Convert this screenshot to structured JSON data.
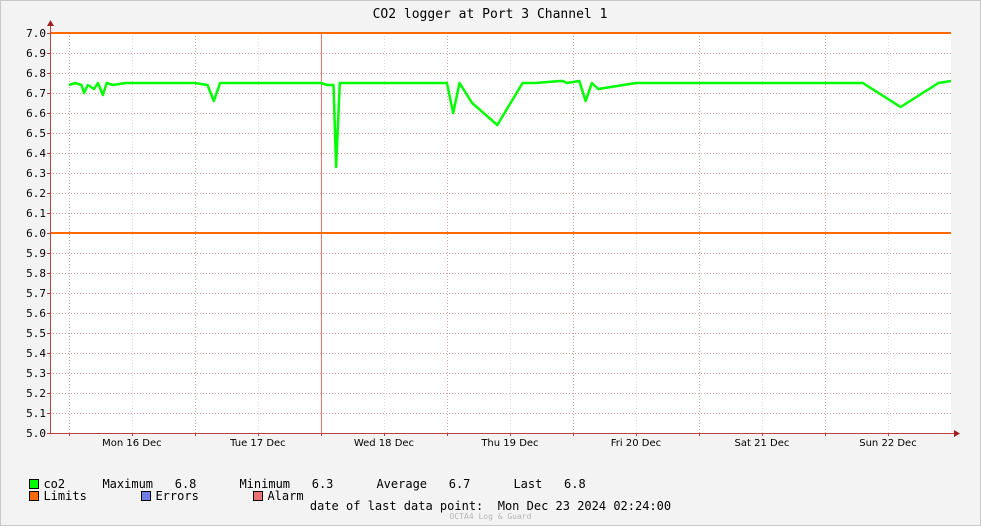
{
  "chart_data": {
    "type": "line",
    "title": "CO2 logger at Port 3 Channel 1",
    "xlabel": "",
    "ylabel": "",
    "ylim": [
      5.0,
      7.0
    ],
    "yticks": [
      "7.0",
      "6.9",
      "6.8",
      "6.7",
      "6.6",
      "6.5",
      "6.4",
      "6.3",
      "6.2",
      "6.1",
      "6.0",
      "5.9",
      "5.8",
      "5.7",
      "5.6",
      "5.5",
      "5.4",
      "5.3",
      "5.2",
      "5.1",
      "5.0"
    ],
    "xticks": [
      "Mon 16 Dec",
      "Tue 17 Dec",
      "Wed 18 Dec",
      "Thu 19 Dec",
      "Fri 20 Dec",
      "Sat 21 Dec",
      "Sun 22 Dec"
    ],
    "grid": true,
    "limits": {
      "upper": 7.0,
      "lower": 6.0
    },
    "series": [
      {
        "name": "co2",
        "color": "#00ff00",
        "x_days": [
          0.0,
          0.05,
          0.1,
          0.12,
          0.15,
          0.2,
          0.23,
          0.27,
          0.3,
          0.35,
          0.45,
          0.5,
          0.7,
          0.9,
          1.0,
          1.1,
          1.15,
          1.2,
          1.4,
          1.7,
          2.0,
          2.05,
          2.1,
          2.12,
          2.15,
          2.3,
          2.6,
          2.8,
          3.0,
          3.05,
          3.1,
          3.2,
          3.4,
          3.6,
          3.7,
          3.9,
          3.92,
          3.95,
          4.05,
          4.1,
          4.15,
          4.2,
          4.5,
          4.9,
          5.1,
          5.3,
          5.5,
          5.8,
          6.1,
          6.2,
          6.3,
          6.6,
          6.9,
          7.0
        ],
        "values": [
          6.74,
          6.75,
          6.74,
          6.7,
          6.74,
          6.72,
          6.75,
          6.69,
          6.75,
          6.74,
          6.75,
          6.75,
          6.75,
          6.75,
          6.75,
          6.74,
          6.66,
          6.75,
          6.75,
          6.75,
          6.75,
          6.74,
          6.74,
          6.33,
          6.75,
          6.75,
          6.75,
          6.75,
          6.75,
          6.6,
          6.75,
          6.65,
          6.54,
          6.75,
          6.75,
          6.76,
          6.76,
          6.75,
          6.76,
          6.66,
          6.75,
          6.72,
          6.75,
          6.75,
          6.75,
          6.75,
          6.75,
          6.75,
          6.75,
          6.75,
          6.75,
          6.63,
          6.75,
          6.76
        ]
      }
    ],
    "x_range_days": [
      -0.15,
      7.0
    ]
  },
  "colors": {
    "background": "#f3f3f3",
    "plot_background": "#ffffff",
    "grid": "#e08080",
    "limits": "#ff6a00",
    "series": "#00ff00",
    "errors": "#6f7fe8",
    "alarm": "#ee7070",
    "cursor": "#ff7070"
  },
  "legend": {
    "co2_label": "co2",
    "maximum_label": "Maximum",
    "maximum_value": "6.8",
    "minimum_label": "Minimum",
    "minimum_value": "6.3",
    "average_label": "Average",
    "average_value": "6.7",
    "last_label": "Last",
    "last_value": "6.8",
    "limits_label": "Limits",
    "errors_label": "Errors",
    "alarm_label": "Alarm"
  },
  "footer": {
    "last_point_label": "date of last data point:",
    "last_point_value": "Mon Dec 23 2024 02:24:00",
    "credit": "OCTA4 Log & Guard"
  }
}
